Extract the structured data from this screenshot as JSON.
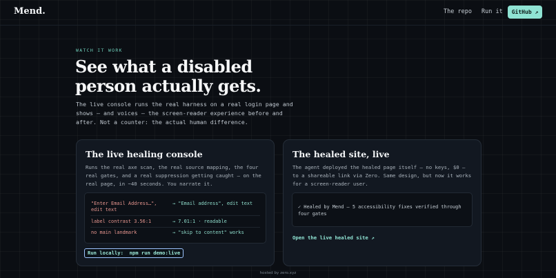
{
  "nav": {
    "logo": "Mend.",
    "links": [
      "The repo",
      "Run it"
    ],
    "github_label": "GitHub ↗"
  },
  "hero": {
    "eyebrow": "WATCH IT WORK",
    "headline": "See what a disabled person actually gets.",
    "intro": "The live console runs the real harness on a real login page and shows — and voices — the screen-reader experience before and after. Not a counter: the actual human difference."
  },
  "console_card": {
    "title": "The live healing console",
    "description": "Runs the real axe scan, the real source mapping, the four real gates, and a real suppression getting caught — on the real page, in ~40 seconds. You narrate it.",
    "rows": [
      {
        "before": "\"Enter Email Address…\", edit text",
        "after": "→ \"Email address\", edit text"
      },
      {
        "before": "label contrast 3.56:1",
        "after": "→ 7.01:1 · readable"
      },
      {
        "before": "no main landmark",
        "after": "→ \"skip to content\" works"
      }
    ],
    "run_label": "Run locally:  npm run demo:live"
  },
  "healed_card": {
    "title": "The healed site, live",
    "description": "The agent deployed the healed page itself — no keys, $0 — to a shareable link via Zero. Same design, but now it works for a screen-reader user.",
    "status": "✓ Healed by Mend — 5 accessibility fixes verified through four gates",
    "link_label": "Open the live healed site ↗"
  },
  "footer": {
    "hosted": "hosted by zero.xyz"
  },
  "colors": {
    "accent": "#8fe3d3",
    "before_text": "#e7968f",
    "after_text": "#8fdccb",
    "background": "#0b0e13"
  }
}
